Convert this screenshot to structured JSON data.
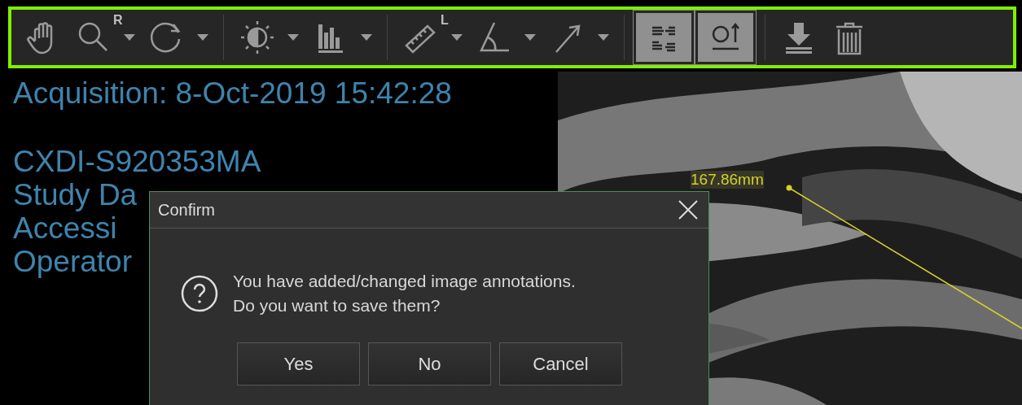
{
  "toolbar": {
    "groups": [
      [
        {
          "kind": "hand",
          "selected": false,
          "dropdown": false
        },
        {
          "kind": "zoom",
          "badge": "R",
          "selected": false,
          "dropdown": true
        },
        {
          "kind": "rotate",
          "selected": false,
          "dropdown": true
        }
      ],
      [
        {
          "kind": "contrast",
          "selected": false,
          "dropdown": true
        },
        {
          "kind": "histogram",
          "selected": false,
          "dropdown": true
        }
      ],
      [
        {
          "kind": "ruler",
          "badge": "L",
          "selected": false,
          "dropdown": true
        },
        {
          "kind": "angle",
          "selected": false,
          "dropdown": true
        },
        {
          "kind": "arrow",
          "selected": false,
          "dropdown": true
        }
      ],
      [
        {
          "kind": "layout",
          "selected": true,
          "dropdown": false
        },
        {
          "kind": "orient",
          "selected": true,
          "dropdown": false
        }
      ],
      [
        {
          "kind": "download",
          "selected": false,
          "dropdown": false
        },
        {
          "kind": "trash",
          "selected": false,
          "dropdown": false
        }
      ]
    ]
  },
  "info": {
    "header": "Acquisition: 8-Oct-2019 15:42:28",
    "lines": [
      "CXDI-S920353MA",
      "Study Da",
      "Accessi",
      "Operator"
    ]
  },
  "image": {
    "measurement": {
      "label": "167.86mm"
    }
  },
  "dialog": {
    "title": "Confirm",
    "message_lines": [
      "You have added/changed image annotations.",
      "Do you want to save them?"
    ],
    "buttons": [
      "Yes",
      "No",
      "Cancel"
    ]
  }
}
